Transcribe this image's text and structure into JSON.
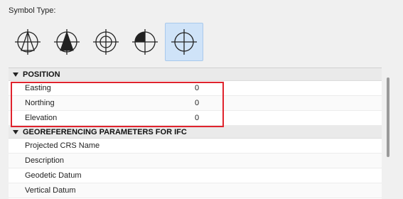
{
  "symbol_type": {
    "label": "Symbol Type:",
    "options": [
      {
        "name": "north-arrow-outline",
        "selected": false
      },
      {
        "name": "north-arrow-filled",
        "selected": false
      },
      {
        "name": "crosshair-circle",
        "selected": false
      },
      {
        "name": "quarter-filled-circle",
        "selected": false
      },
      {
        "name": "crosshair-plain",
        "selected": true
      }
    ]
  },
  "sections": {
    "position": {
      "title": "POSITION",
      "rows": [
        {
          "label": "Easting",
          "value": "0"
        },
        {
          "label": "Northing",
          "value": "0"
        },
        {
          "label": "Elevation",
          "value": "0"
        }
      ]
    },
    "georef": {
      "title": "GEOREFERENCING PARAMETERS FOR IFC",
      "rows": [
        {
          "label": "Projected CRS Name"
        },
        {
          "label": "Description"
        },
        {
          "label": "Geodetic Datum"
        },
        {
          "label": "Vertical Datum"
        }
      ]
    }
  },
  "colors": {
    "highlight": "#e0232d",
    "selected_bg": "#cfe3f8"
  }
}
